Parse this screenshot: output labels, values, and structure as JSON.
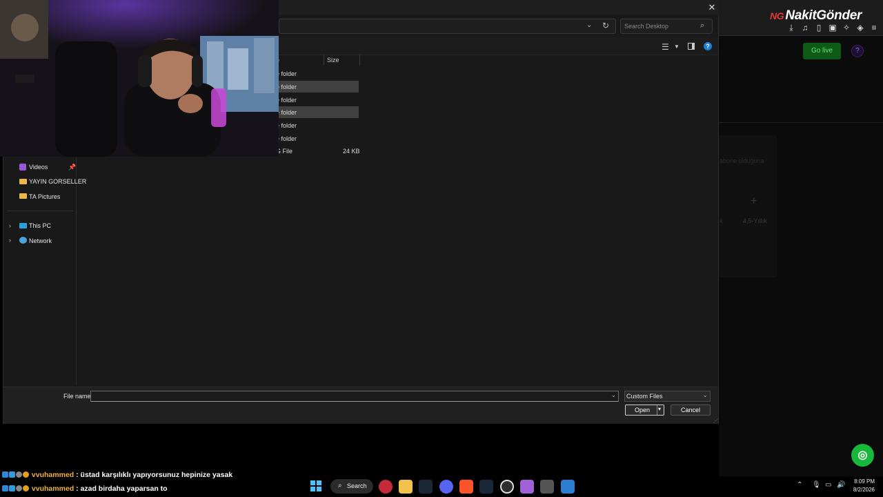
{
  "browser": {
    "brand": "NakitGönder",
    "go_live_label": "Go live",
    "subscribe_fragment": "abone olduğuna",
    "plan_label": "4,5-Yıllık",
    "plan_k": "k",
    "plus": "+"
  },
  "dialog": {
    "search_placeholder": "Search Desktop",
    "columns": {
      "name": "e",
      "size": "Size"
    },
    "rows": [
      {
        "type": "e folder",
        "size": "",
        "selected": false
      },
      {
        "type": "e folder",
        "size": "",
        "selected": true
      },
      {
        "type": "e folder",
        "size": "",
        "selected": false
      },
      {
        "type": "e folder",
        "size": "",
        "selected": true
      },
      {
        "type": "e folder",
        "size": "",
        "selected": false
      },
      {
        "type": "e folder",
        "size": "",
        "selected": false
      },
      {
        "type": "G File",
        "size": "24 KB",
        "selected": false
      }
    ],
    "nav": {
      "videos": "Videos",
      "yayin": "YAYIN GORSELLER",
      "ta": "TA Pictures",
      "this_pc": "This PC",
      "network": "Network"
    },
    "file_name_label": "File name:",
    "file_name_value": "",
    "filter_value": "Custom Files",
    "open_label": "Open",
    "cancel_label": "Cancel"
  },
  "chat": [
    {
      "user": "vvuhammed",
      "message": " : üstad karşılıklı yapıyorsunuz hepinize yasak"
    },
    {
      "user": "vvuhammed",
      "message": " : azad birdaha yaparsan to"
    }
  ],
  "taskbar": {
    "search_label": "Search",
    "time": "8:09 PM",
    "date": "8/2/2026"
  },
  "colors": {
    "accent_blue": "#1d7fd6",
    "go_live_green": "#0c5a16",
    "support_green": "#18b83c",
    "chat_user": "#f0b33a"
  }
}
